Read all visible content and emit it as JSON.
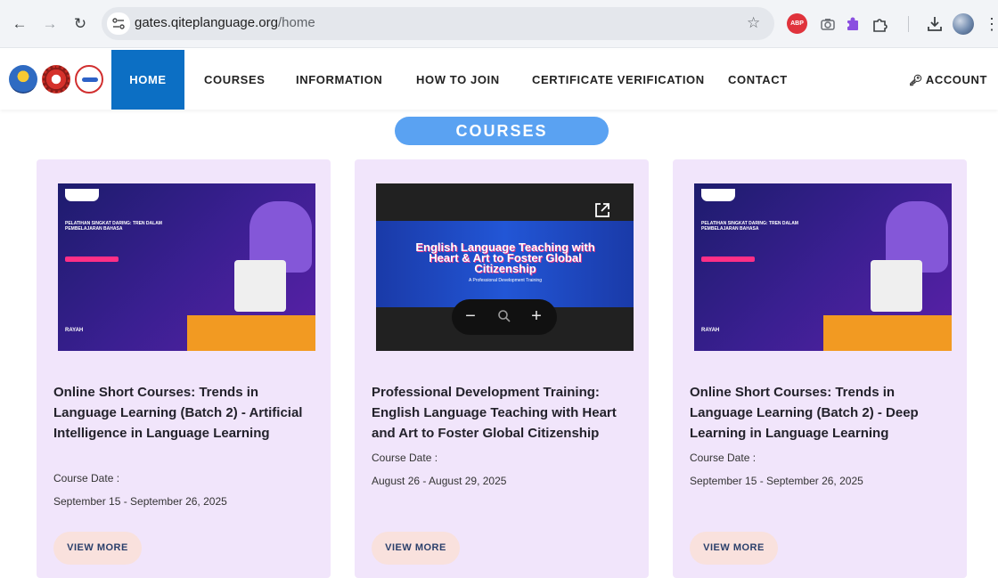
{
  "browser": {
    "url_host": "gates.qiteplanguage.org",
    "url_path": "/home",
    "extensions": [
      "adblock-plus-icon",
      "camera-icon",
      "purple-puzzle-icon",
      "puzzle-icon",
      "download-icon",
      "profile-avatar",
      "more-menu-icon"
    ],
    "abp_label": "ABP"
  },
  "header": {
    "menu": [
      {
        "label": "HOME",
        "active": true
      },
      {
        "label": "COURSES"
      },
      {
        "label": "INFORMATION"
      },
      {
        "label": "HOW TO JOIN"
      },
      {
        "label": "CERTIFICATE VERIFICATION"
      },
      {
        "label": "CONTACT"
      }
    ],
    "account_label": "ACCOUNT"
  },
  "section_title": "COURSES",
  "cards": [
    {
      "title": "Online Short Courses: Trends in Language Learning (Batch 2) - Artificial Intelligence in Language Learning",
      "date_label": "Course Date :",
      "date": "September 15 - September 26, 2025",
      "button": "VIEW MORE"
    },
    {
      "title": "Professional Development Training: English Language Teaching with Heart and Art to Foster Global Citizenship",
      "date_label": "Course Date :",
      "date": "August 26 - August 29, 2025",
      "button": "VIEW MORE",
      "banner_title": "English Language Teaching with Heart & Art to Foster Global Citizenship",
      "banner_sub": "A Professional Development Training"
    },
    {
      "title": "Online Short Courses: Trends in Language Learning (Batch 2) - Deep Learning in Language Learning",
      "date_label": "Course Date :",
      "date": "September 15 - September 26, 2025",
      "button": "VIEW MORE"
    }
  ],
  "thumb_text": {
    "headline": "PELATIHAN SINGKAT DARING: TREN DALAM PEMBELAJARAN BAHASA",
    "footer": "RAYAH"
  },
  "colors": {
    "active_menu": "#0c6fc4",
    "section_pill": "#5aa2f2",
    "card_bg": "#f1e5fb",
    "button_bg": "#f9e1dd",
    "button_text": "#2a3f6b"
  }
}
